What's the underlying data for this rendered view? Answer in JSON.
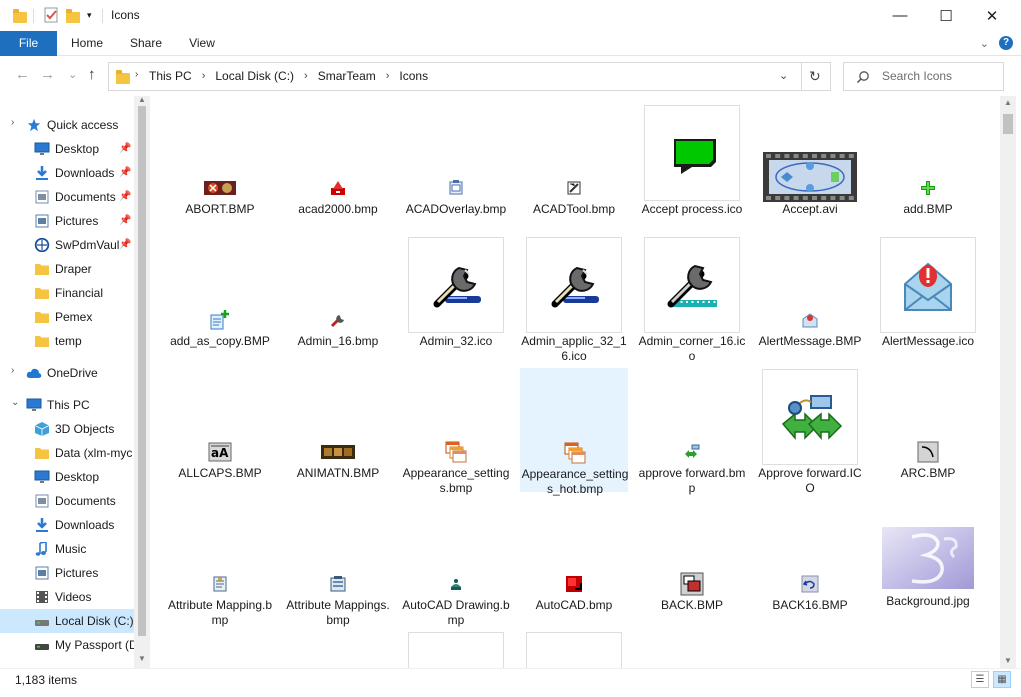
{
  "window": {
    "title": "Icons"
  },
  "controls": {
    "minimize": "—",
    "maximize": "☐",
    "close": "✕"
  },
  "ribbon": {
    "tabs": [
      "File",
      "Home",
      "Share",
      "View"
    ],
    "expand": "⌄",
    "help": "?"
  },
  "nav_buttons": {
    "back": "←",
    "forward": "→",
    "recent": "⌄",
    "up": "↑",
    "refresh": "↻",
    "dropdown": "⌄"
  },
  "address": {
    "crumbs": [
      "This PC",
      "Local Disk (C:)",
      "SmarTeam",
      "Icons"
    ]
  },
  "search": {
    "placeholder": "Search Icons"
  },
  "nav": {
    "items": [
      {
        "label": "Quick access",
        "icon": "star-icon",
        "color": "#2a7bd6"
      },
      {
        "label": "Desktop",
        "icon": "desktop-icon",
        "color": "#2b79d0",
        "pin": "📌"
      },
      {
        "label": "Downloads",
        "icon": "downloads-icon",
        "color": "#2b79d0",
        "pin": "📌"
      },
      {
        "label": "Documents",
        "icon": "documents-icon",
        "color": "#7b8da8",
        "pin": "📌"
      },
      {
        "label": "Pictures",
        "icon": "pictures-icon",
        "color": "#5a7fa8",
        "pin": "📌"
      },
      {
        "label": "SwPdmVaul",
        "icon": "vault-icon",
        "color": "#1a4f9c",
        "pin": "📌"
      },
      {
        "label": "Draper",
        "icon": "folder-icon",
        "color": "#f5c542"
      },
      {
        "label": "Financial",
        "icon": "folder-icon",
        "color": "#f5c542"
      },
      {
        "label": "Pemex",
        "icon": "folder-icon",
        "color": "#f5c542"
      },
      {
        "label": "temp",
        "icon": "folder-icon",
        "color": "#f5c542"
      },
      {
        "label": "OneDrive",
        "icon": "cloud-icon",
        "color": "#1f78d1"
      },
      {
        "label": "This PC",
        "icon": "pc-icon",
        "color": "#2b79d0"
      },
      {
        "label": "3D Objects",
        "icon": "cube-icon",
        "color": "#3da0d8"
      },
      {
        "label": "Data (xlm-myc",
        "icon": "folder-icon",
        "color": "#f5c542"
      },
      {
        "label": "Desktop",
        "icon": "desktop-icon",
        "color": "#2b79d0"
      },
      {
        "label": "Documents",
        "icon": "documents-icon",
        "color": "#7b8da8"
      },
      {
        "label": "Downloads",
        "icon": "downloads-icon",
        "color": "#2b79d0"
      },
      {
        "label": "Music",
        "icon": "music-icon",
        "color": "#2b79d0"
      },
      {
        "label": "Pictures",
        "icon": "pictures-icon",
        "color": "#5a7fa8"
      },
      {
        "label": "Videos",
        "icon": "videos-icon",
        "color": "#555555"
      },
      {
        "label": "Local Disk (C:)",
        "icon": "drive-icon",
        "color": "#777777"
      },
      {
        "label": "My Passport (D",
        "icon": "drive-icon",
        "color": "#444444"
      }
    ]
  },
  "files": [
    {
      "name": "ABORT.BMP",
      "icon": "abort-icon"
    },
    {
      "name": "acad2000.bmp",
      "icon": "acad-icon"
    },
    {
      "name": "ACADOverlay.bmp",
      "icon": "overlay-icon"
    },
    {
      "name": "ACADTool.bmp",
      "icon": "tool-icon"
    },
    {
      "name": "Accept process.ico",
      "icon": "accept-process-icon"
    },
    {
      "name": "Accept.avi",
      "icon": "video-icon"
    },
    {
      "name": "add.BMP",
      "icon": "plus-icon"
    },
    {
      "name": "add_as_copy.BMP",
      "icon": "add-copy-icon"
    },
    {
      "name": "Admin_16.bmp",
      "icon": "admin-small-icon"
    },
    {
      "name": "Admin_32.ico",
      "icon": "wrench-icon"
    },
    {
      "name": "Admin_applic_32_16.ico",
      "icon": "wrench-icon"
    },
    {
      "name": "Admin_corner_16.ico",
      "icon": "wrench-corner-icon"
    },
    {
      "name": "AlertMessage.BMP",
      "icon": "alert-small-icon"
    },
    {
      "name": "AlertMessage.ico",
      "icon": "alert-envelope-icon"
    },
    {
      "name": "ALLCAPS.BMP",
      "icon": "allcaps-icon"
    },
    {
      "name": "ANIMATN.BMP",
      "icon": "film-icon"
    },
    {
      "name": "Appearance_settings.bmp",
      "icon": "windows-icon"
    },
    {
      "name": "Appearance_settings_hot.bmp",
      "icon": "windows-icon"
    },
    {
      "name": "approve forward.bmp",
      "icon": "approve-small-icon"
    },
    {
      "name": "Approve forward.ICO",
      "icon": "approve-icon"
    },
    {
      "name": "ARC.BMP",
      "icon": "arc-icon"
    },
    {
      "name": "Attribute Mapping.bmp",
      "icon": "attr-icon"
    },
    {
      "name": "Attribute Mappings.bmp",
      "icon": "attrs-icon"
    },
    {
      "name": "AutoCAD Drawing.bmp",
      "icon": "autocad-drawing-icon"
    },
    {
      "name": "AutoCAD.bmp",
      "icon": "autocad-icon"
    },
    {
      "name": "BACK.BMP",
      "icon": "back-icon"
    },
    {
      "name": "BACK16.BMP",
      "icon": "undo-icon"
    },
    {
      "name": "Background.jpg",
      "icon": "background-image-icon"
    }
  ],
  "status": {
    "text": "1,183 items"
  },
  "colors": {
    "accent": "#1f6fbf",
    "selection": "#cce8ff",
    "hot": "#e5f3ff",
    "green": "#00c800"
  }
}
